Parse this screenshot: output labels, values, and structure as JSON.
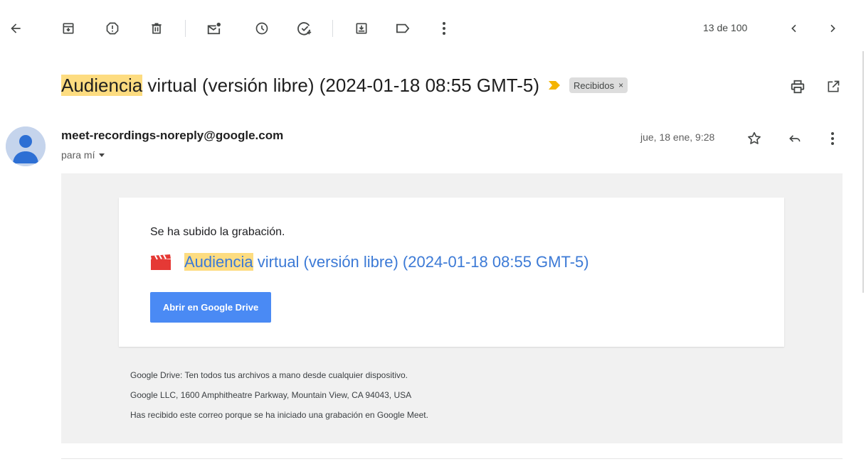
{
  "toolbar": {
    "icons": [
      "back-arrow-icon",
      "archive-icon",
      "report-spam-icon",
      "delete-icon",
      "mark-unread-icon",
      "snooze-icon",
      "add-to-tasks-icon",
      "move-to-icon",
      "labels-icon",
      "more-vert-icon"
    ],
    "pager": "13 de 100"
  },
  "subject": {
    "highlight": "Audiencia",
    "rest": " virtual (versión libre) (2024-01-18 08:55 GMT-5)",
    "label": "Recibidos",
    "label_close": "×",
    "importance_color": "#f4b400"
  },
  "sender": {
    "email": "meet-recordings-noreply@google.com",
    "to": "para mí",
    "date": "jue, 18 ene, 9:28"
  },
  "body": {
    "message": "Se ha subido la grabación.",
    "file_highlight": "Audiencia",
    "file_rest": " virtual (versión libre) (2024-01-18 08:55 GMT-5)",
    "button": "Abrir en Google Drive",
    "footer": [
      "Google Drive: Ten todos tus archivos a mano desde cualquier dispositivo.",
      "Google LLC, 1600 Amphitheatre Parkway, Mountain View, CA 94043, USA",
      "Has recibido este correo porque se ha iniciado una grabación en Google Meet."
    ]
  },
  "colors": {
    "highlight": "#fddc80",
    "link": "#3c7ad6",
    "button": "#4a8af4",
    "email_bg": "#f1f1f1"
  }
}
